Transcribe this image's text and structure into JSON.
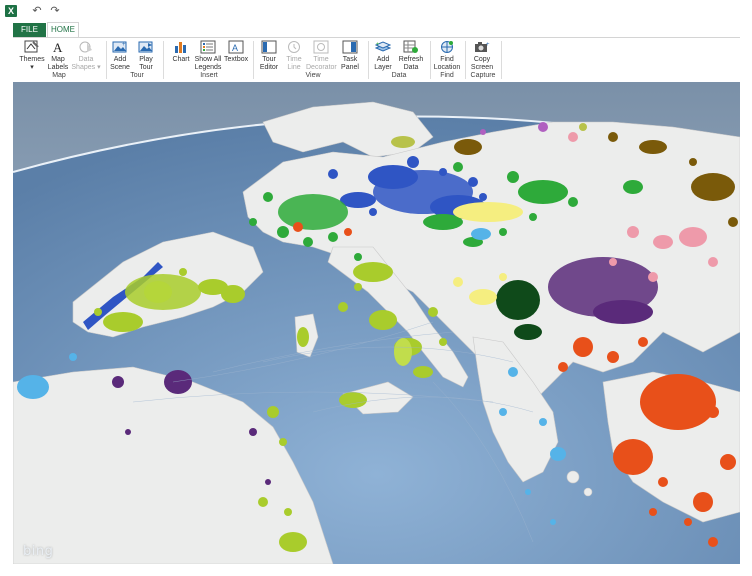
{
  "qat": {
    "app_icon": "excel-icon",
    "undo_icon": "undo-icon",
    "redo_icon": "redo-icon"
  },
  "tabs": [
    {
      "label": "FILE"
    },
    {
      "label": "HOME"
    }
  ],
  "ribbon": {
    "buttons": [
      {
        "name": "themes",
        "label1": "Themes",
        "label2": "▾",
        "icon": "themes-icon",
        "enabled": true
      },
      {
        "name": "map-labels",
        "label1": "Map",
        "label2": "Labels",
        "icon": "map-labels-icon",
        "enabled": true
      },
      {
        "name": "data-shapes",
        "label1": "Data",
        "label2": "Shapes ▾",
        "icon": "data-shapes-icon",
        "enabled": false
      },
      {
        "name": "add-scene",
        "label1": "Add",
        "label2": "Scene",
        "icon": "add-scene-icon",
        "enabled": true
      },
      {
        "name": "play-tour",
        "label1": "Play",
        "label2": "Tour",
        "icon": "play-tour-icon",
        "enabled": true
      },
      {
        "name": "chart",
        "label1": "Chart",
        "label2": "",
        "icon": "chart-icon",
        "enabled": true
      },
      {
        "name": "show-all-legends",
        "label1": "Show All",
        "label2": "Legends",
        "icon": "legends-icon",
        "enabled": true
      },
      {
        "name": "textbox",
        "label1": "Textbox",
        "label2": "",
        "icon": "textbox-icon",
        "enabled": true
      },
      {
        "name": "tour-editor",
        "label1": "Tour",
        "label2": "Editor",
        "icon": "tour-editor-icon",
        "enabled": true
      },
      {
        "name": "time-line",
        "label1": "Time",
        "label2": "Line",
        "icon": "timeline-icon",
        "enabled": false
      },
      {
        "name": "time-decorator",
        "label1": "Time",
        "label2": "Decorator",
        "icon": "time-decorator-icon",
        "enabled": false
      },
      {
        "name": "task-panel",
        "label1": "Task",
        "label2": "Panel",
        "icon": "task-panel-icon",
        "enabled": true
      },
      {
        "name": "add-layer",
        "label1": "Add",
        "label2": "Layer",
        "icon": "add-layer-icon",
        "enabled": true
      },
      {
        "name": "refresh-data",
        "label1": "Refresh",
        "label2": "Data",
        "icon": "refresh-data-icon",
        "enabled": true
      },
      {
        "name": "find-location",
        "label1": "Find",
        "label2": "Location",
        "icon": "find-location-icon",
        "enabled": true
      },
      {
        "name": "copy-screen",
        "label1": "Copy",
        "label2": "Screen",
        "icon": "camera-icon",
        "enabled": true
      }
    ],
    "groups": [
      {
        "label": "Map"
      },
      {
        "label": "Tour"
      },
      {
        "label": "Insert"
      },
      {
        "label": "View"
      },
      {
        "label": "Data"
      },
      {
        "label": "Find"
      },
      {
        "label": "Capture"
      }
    ]
  },
  "map": {
    "watermark": "bing",
    "ocean_color": "#6e8fb5",
    "land_color": "#ecedec",
    "layer_colors": [
      "#2f55c4",
      "#2eaa3a",
      "#a9cc2c",
      "#5a2a7a",
      "#e8501a",
      "#f5ee80",
      "#7a5a0a",
      "#ee9aaa",
      "#55b3e8",
      "#0f4a1a"
    ]
  }
}
